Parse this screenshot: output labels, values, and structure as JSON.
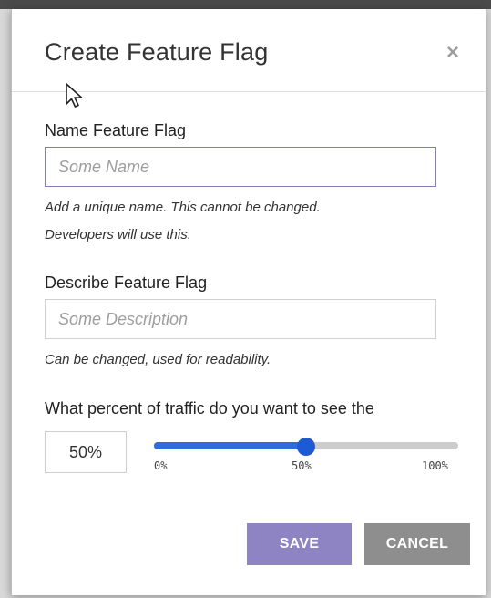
{
  "modal": {
    "title": "Create Feature Flag",
    "close_label": "×"
  },
  "name_field": {
    "label": "Name Feature Flag",
    "placeholder": "Some Name",
    "value": "",
    "help_line1": "Add a unique name. This cannot be changed.",
    "help_line2": "Developers will use this."
  },
  "description_field": {
    "label": "Describe Feature Flag",
    "placeholder": "Some Description",
    "value": "",
    "help": "Can be changed, used for readability."
  },
  "traffic": {
    "label": "What percent of traffic do you want to see the",
    "value_text": "50%",
    "value": 50,
    "min": 0,
    "max": 100,
    "ticks": [
      "0%",
      "50%",
      "100%"
    ]
  },
  "actions": {
    "save_label": "SAVE",
    "cancel_label": "CANCEL"
  },
  "colors": {
    "save_button": "#8e84c4",
    "cancel_button": "#8e8e8e",
    "slider_fill": "#2f6bdb",
    "slider_track": "#cccccc"
  },
  "icons": {
    "close": "close-icon",
    "cursor": "mouse-cursor-icon"
  }
}
